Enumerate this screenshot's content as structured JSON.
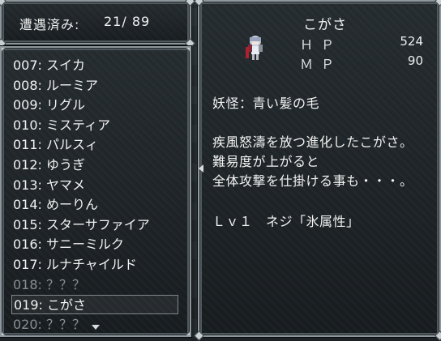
{
  "counter": {
    "label": "遭遇済み:",
    "value": "21/ 89"
  },
  "list": {
    "items": [
      {
        "text": "007: スイカ",
        "state": "normal"
      },
      {
        "text": "008: ルーミア",
        "state": "normal"
      },
      {
        "text": "009: リグル",
        "state": "normal"
      },
      {
        "text": "010: ミスティア",
        "state": "normal"
      },
      {
        "text": "011: パルスィ",
        "state": "normal"
      },
      {
        "text": "012: ゆうぎ",
        "state": "normal"
      },
      {
        "text": "013: ヤマメ",
        "state": "normal"
      },
      {
        "text": "014: めーりん",
        "state": "normal"
      },
      {
        "text": "015: スターサファイア",
        "state": "normal"
      },
      {
        "text": "016: サニーミルク",
        "state": "normal"
      },
      {
        "text": "017: ルナチャイルド",
        "state": "normal"
      },
      {
        "text": "018: ？？？",
        "state": "dim"
      },
      {
        "text": "019: こがさ",
        "state": "selected"
      },
      {
        "text": "020: ？？？",
        "state": "dim"
      }
    ]
  },
  "detail": {
    "name": "こがさ",
    "hp_label": "ＨＰ",
    "hp_value": "524",
    "mp_label": "ＭＰ",
    "mp_value": "90",
    "category": "妖怪：青い髪の毛",
    "description_1": "疾風怒濤を放つ進化したこがさ。",
    "description_2": "難易度が上がると",
    "description_3": "全体攻撃を仕掛ける事も・・・。",
    "skill": "Ｌｖ１　ネジ「氷属性」",
    "sprite_icon": "kogasa-sprite-icon"
  },
  "colors": {
    "window_border": "#8e979c",
    "text": "#f2f2f2",
    "dim_text": "#8a8f93"
  }
}
